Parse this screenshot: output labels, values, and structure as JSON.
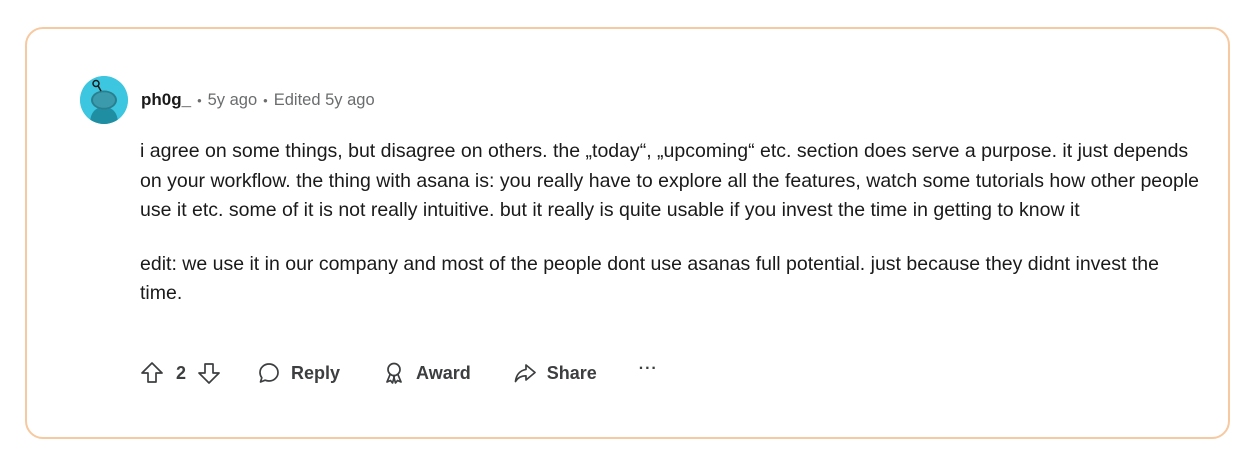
{
  "comment": {
    "username": "ph0g_",
    "separator": "•",
    "age": "5y ago",
    "edited": "Edited 5y ago",
    "paragraphs": [
      "i agree on some things, but disagree on others. the „today“, „upcoming“ etc. section does serve a purpose. it just depends on your workflow. the thing with asana is: you really have to explore all the features, watch some tutorials how other people use it etc. some of it is not really intuitive. but it really is quite usable if you invest the time in getting to know it",
      "edit: we use it in our company and most of the people dont use asanas full potential. just because they didnt invest the time."
    ]
  },
  "actions": {
    "vote_count": "2",
    "reply_label": "Reply",
    "award_label": "Award",
    "share_label": "Share",
    "more_label": "···"
  },
  "icons": {
    "avatar": "snoo-avatar-icon",
    "upvote": "upvote-arrow-icon",
    "downvote": "downvote-arrow-icon",
    "reply": "speech-bubble-icon",
    "award": "award-ribbon-icon",
    "share": "share-arrow-icon"
  },
  "colors": {
    "card_border": "#f7c9a0",
    "avatar_bg": "#3dc6e0",
    "muted_text": "#6a6c6e"
  }
}
